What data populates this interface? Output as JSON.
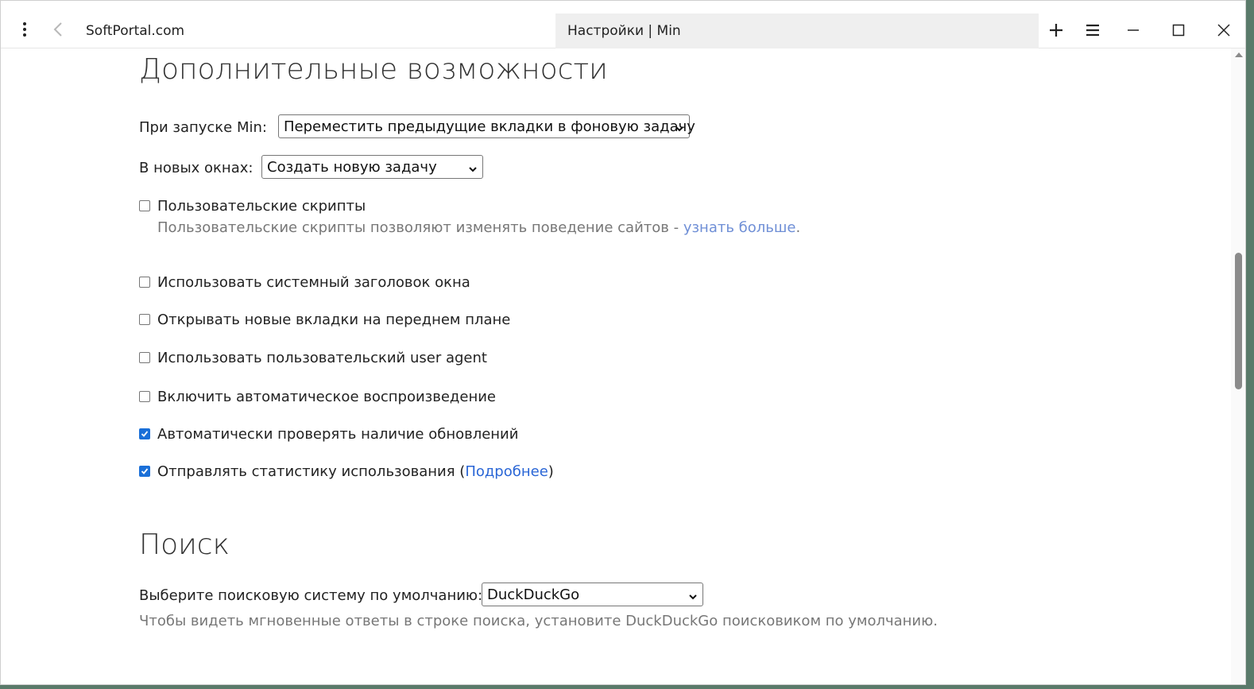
{
  "browser": {
    "site_tab": "SoftPortal.com",
    "active_tab": "Настройки | Min"
  },
  "advanced": {
    "title": "Дополнительные возможности",
    "startup_label": "При запуске Min:",
    "startup_value": "Переместить предыдущие вкладки в фоновую задачу",
    "new_windows_label": "В новых окнах:",
    "new_windows_value": "Создать новую задачу",
    "checkboxes": [
      {
        "label": "Пользовательские скрипты",
        "checked": false
      },
      {
        "label": "Использовать системный заголовок окна",
        "checked": false
      },
      {
        "label": "Открывать новые вкладки на переднем плане",
        "checked": false
      },
      {
        "label": "Использовать пользовательский user agent",
        "checked": false
      },
      {
        "label": "Включить автоматическое воспроизведение",
        "checked": false
      },
      {
        "label": "Автоматически проверять наличие обновлений",
        "checked": true
      },
      {
        "label": "Отправлять статистику использования (",
        "checked": true
      }
    ],
    "userscripts_desc": "Пользовательские скрипты позволяют изменять поведение сайтов - ",
    "userscripts_link": "узнать больше",
    "userscripts_period": ".",
    "stats_link": "Подробнее",
    "stats_close": ")"
  },
  "search": {
    "title": "Поиск",
    "engine_label": "Выберите поисковую систему по умолчанию:",
    "engine_value": "DuckDuckGo",
    "hint": "Чтобы видеть мгновенные ответы в строке поиска, установите DuckDuckGo поисковиком по умолчанию."
  }
}
